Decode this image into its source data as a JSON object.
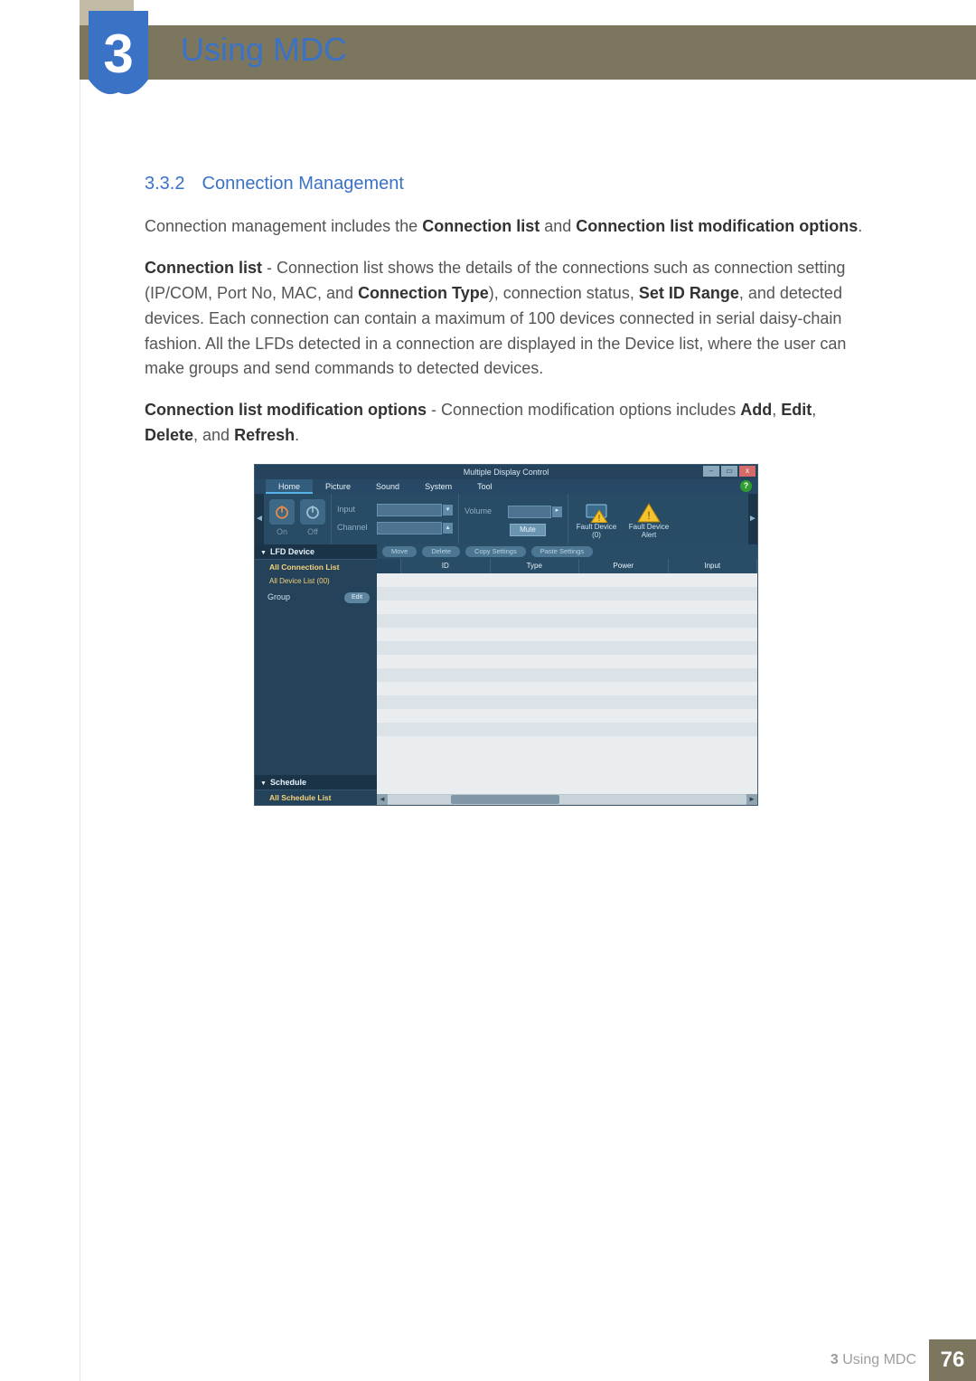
{
  "chapter": {
    "number": "3",
    "title": "Using MDC"
  },
  "section": {
    "number": "3.3.2",
    "title": "Connection Management"
  },
  "paragraphs": {
    "p1_a": "Connection management includes the ",
    "p1_b1": "Connection list",
    "p1_c": " and ",
    "p1_b2": "Connection list modification options",
    "p1_d": ".",
    "p2_b1": "Connection list",
    "p2_a": " - Connection list shows the details of the connections such as connection setting (IP/COM, Port No, MAC, and ",
    "p2_b2": "Connection Type",
    "p2_b": "), connection status, ",
    "p2_b3": "Set ID Range",
    "p2_c": ", and detected devices. Each connection can contain a maximum of 100 devices connected in serial daisy-chain fashion. All the LFDs detected in a connection are displayed in the Device list, where the user can make groups and send commands to detected devices.",
    "p3_b1": "Connection list modification options",
    "p3_a": " - Connection modification options includes ",
    "p3_b2": "Add",
    "p3_s1": ", ",
    "p3_b3": "Edit",
    "p3_s2": ", ",
    "p3_b4": "Delete",
    "p3_s3": ", and ",
    "p3_b5": "Refresh",
    "p3_d": "."
  },
  "app": {
    "title": "Multiple Display Control",
    "menu": {
      "home": "Home",
      "picture": "Picture",
      "sound": "Sound",
      "system": "System",
      "tool": "Tool"
    },
    "help": "?",
    "toolbar": {
      "on": "On",
      "off": "Off",
      "input": "Input",
      "channel": "Channel",
      "volume": "Volume",
      "mute": "Mute",
      "fault_device_count": "Fault Device (0)",
      "fault_device_alert": "Fault Device Alert"
    },
    "actions": {
      "move": "Move",
      "delete": "Delete",
      "copy": "Copy Settings",
      "paste": "Paste Settings"
    },
    "columns": {
      "id": "ID",
      "type": "Type",
      "power": "Power",
      "input": "Input"
    },
    "sidebar": {
      "lfd": "LFD Device",
      "all_conn": "All Connection List",
      "all_dev": "All Device List (00)",
      "group": "Group",
      "edit": "Edit",
      "schedule": "Schedule",
      "all_sched": "All Schedule List"
    },
    "win": {
      "min": "–",
      "max": "▭",
      "close": "x"
    },
    "arrows": {
      "left": "◄",
      "right": "►"
    }
  },
  "footer": {
    "label_num": "3",
    "label_text": " Using MDC",
    "page": "76"
  }
}
